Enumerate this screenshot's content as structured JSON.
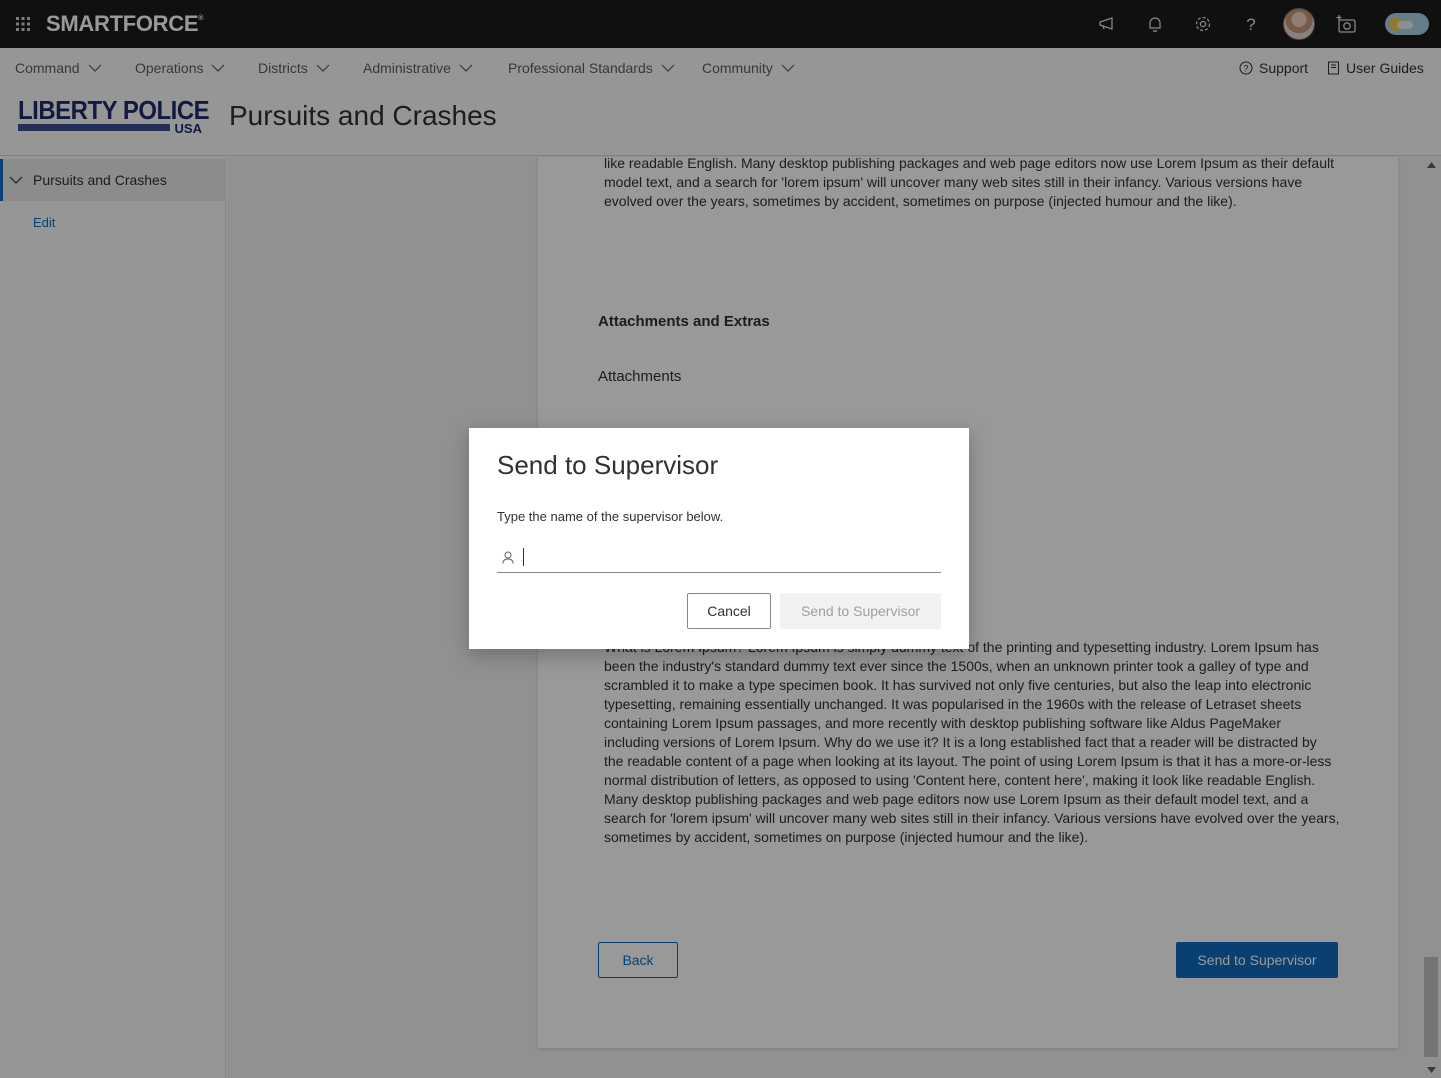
{
  "app": {
    "brand": "SMARTFORCE",
    "brand_mark": "®"
  },
  "topbar": {
    "icons": [
      "waffle-icon",
      "megaphone-icon",
      "bell-icon",
      "gear-icon",
      "help-icon",
      "avatar",
      "add-camera-icon",
      "theme-toggle"
    ]
  },
  "nav": {
    "items": [
      {
        "label": "Command"
      },
      {
        "label": "Operations"
      },
      {
        "label": "Districts"
      },
      {
        "label": "Administrative"
      },
      {
        "label": "Professional Standards"
      },
      {
        "label": "Community"
      }
    ],
    "support_label": "Support",
    "guides_label": "User Guides"
  },
  "header": {
    "logo_text": "LIBERTY POLICE",
    "logo_sub": "USA",
    "page_title": "Pursuits and Crashes"
  },
  "sidebar": {
    "active_label": "Pursuits and Crashes",
    "sub_item": "Edit"
  },
  "content": {
    "top_paragraph": "like readable English. Many desktop publishing packages and web page editors now use Lorem Ipsum as their default model text, and a search for 'lorem ipsum' will uncover many web sites still in their infancy. Various versions have evolved over the years, sometimes by accident, sometimes on purpose (injected humour and the like).",
    "section_heading": "Attachments and Extras",
    "section_sub": "Attachments",
    "body_paragraph": "What is Lorem Ipsum? Lorem Ipsum is simply dummy text of the printing and typesetting industry. Lorem Ipsum has been the industry's standard dummy text ever since the 1500s, when an unknown printer took a galley of type and scrambled it to make a type specimen book. It has survived not only five centuries, but also the leap into electronic typesetting, remaining essentially unchanged. It was popularised in the 1960s with the release of Letraset sheets containing Lorem Ipsum passages, and more recently with desktop publishing software like Aldus PageMaker including versions of Lorem Ipsum. Why do we use it? It is a long established fact that a reader will be distracted by the readable content of a page when looking at its layout. The point of using Lorem Ipsum is that it has a more-or-less normal distribution of letters, as opposed to using 'Content here, content here', making it look like readable English. Many desktop publishing packages and web page editors now use Lorem Ipsum as their default model text, and a search for 'lorem ipsum' will uncover many web sites still in their infancy. Various versions have evolved over the years, sometimes by accident, sometimes on purpose (injected humour and the like).",
    "back_label": "Back",
    "send_label": "Send to Supervisor"
  },
  "dialog": {
    "title": "Send to Supervisor",
    "subtitle": "Type the name of the supervisor below.",
    "input_value": "",
    "cancel_label": "Cancel",
    "send_label": "Send to Supervisor",
    "send_disabled": true
  },
  "colors": {
    "accent": "#0f6cbd",
    "topbar": "#1b1b1b",
    "logo": "#1f2c6b"
  }
}
